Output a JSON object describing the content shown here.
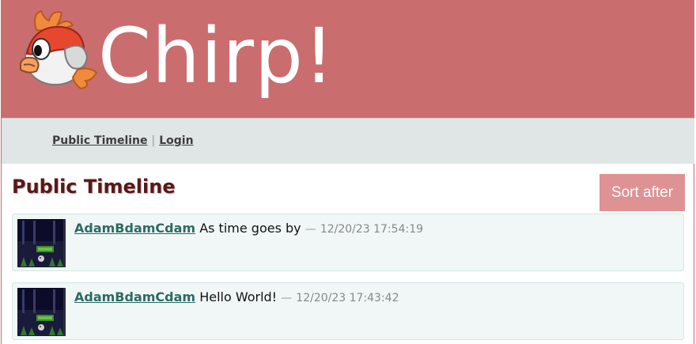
{
  "header": {
    "title": "Chirp!"
  },
  "nav": {
    "public_timeline": "Public Timeline",
    "separator": "|",
    "login": "Login"
  },
  "main": {
    "title": "Public Timeline",
    "sort_button": "Sort after",
    "messages": [
      {
        "author": "AdamBdamCdam",
        "text": "As time goes by",
        "dash": "—",
        "timestamp": "12/20/23 17:54:19"
      },
      {
        "author": "AdamBdamCdam",
        "text": "Hello World!",
        "dash": "—",
        "timestamp": "12/20/23 17:43:42"
      }
    ]
  },
  "colors": {
    "header_bg": "#ca6d6f",
    "nav_bg": "#dfe6e5",
    "title_color": "#5a1818",
    "button_bg": "#de9293",
    "link_color": "#2b6b63",
    "message_bg": "#f0f7f6"
  },
  "icons": {
    "logo": "bird-logo-icon",
    "avatar": "user-avatar"
  }
}
